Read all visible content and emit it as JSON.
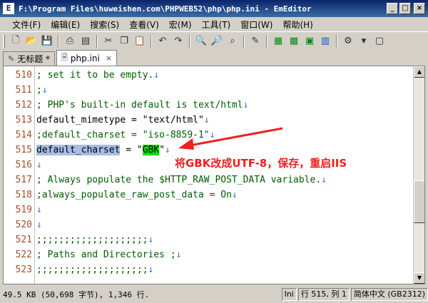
{
  "window": {
    "title": "F:\\Program Files\\huweishen.com\\PHPWEB52\\php\\php.ini - EmEditor",
    "icon_name": "emeditor-app-icon",
    "minimize": "_",
    "maximize": "□",
    "close": "×"
  },
  "menu": [
    {
      "label": "文件(F)"
    },
    {
      "label": "编辑(E)"
    },
    {
      "label": "搜索(S)"
    },
    {
      "label": "查看(V)"
    },
    {
      "label": "宏(M)"
    },
    {
      "label": "工具(T)"
    },
    {
      "label": "窗口(W)"
    },
    {
      "label": "帮助(H)"
    }
  ],
  "tabs": [
    {
      "label": "无标题 *",
      "icon": "document-edit-icon",
      "active": false
    },
    {
      "label": "php.ini",
      "icon": "document-icon",
      "active": true,
      "close": "×"
    }
  ],
  "editor": {
    "lines": [
      {
        "num": "510",
        "text": "; set it to be empty."
      },
      {
        "num": "511",
        "text": ";"
      },
      {
        "num": "512",
        "text": "; PHP's built-in default is text/html"
      },
      {
        "num": "513",
        "text": "default_mimetype = \"text/html\""
      },
      {
        "num": "514",
        "text": ";default_charset = \"iso-8859-1\""
      },
      {
        "num": "515",
        "key": "default_charset",
        "mid": " = \"",
        "value": "GBK",
        "end": "\""
      },
      {
        "num": "516",
        "text": ""
      },
      {
        "num": "517",
        "text": "; Always populate the $HTTP_RAW_POST_DATA variable."
      },
      {
        "num": "518",
        "text": ";always_populate_raw_post_data = On"
      },
      {
        "num": "519",
        "text": ""
      },
      {
        "num": "520",
        "text": ""
      },
      {
        "num": "521",
        "text": ";;;;;;;;;;;;;;;;;;;;"
      },
      {
        "num": "522",
        "text": "; Paths and Directories ;"
      },
      {
        "num": "523",
        "text": ";;;;;;;;;;;;;;;;;;;;"
      }
    ],
    "newline_mark": "↓"
  },
  "annotation": {
    "text": "将GBK改成UTF-8，保存，重启IIS",
    "color": "#f02020"
  },
  "status": {
    "left": "49.5 KB (50,698 字节), 1,346 行.",
    "cells": [
      "Ini",
      "行 515, 列 1",
      "简体中文 (GB2312)"
    ]
  }
}
